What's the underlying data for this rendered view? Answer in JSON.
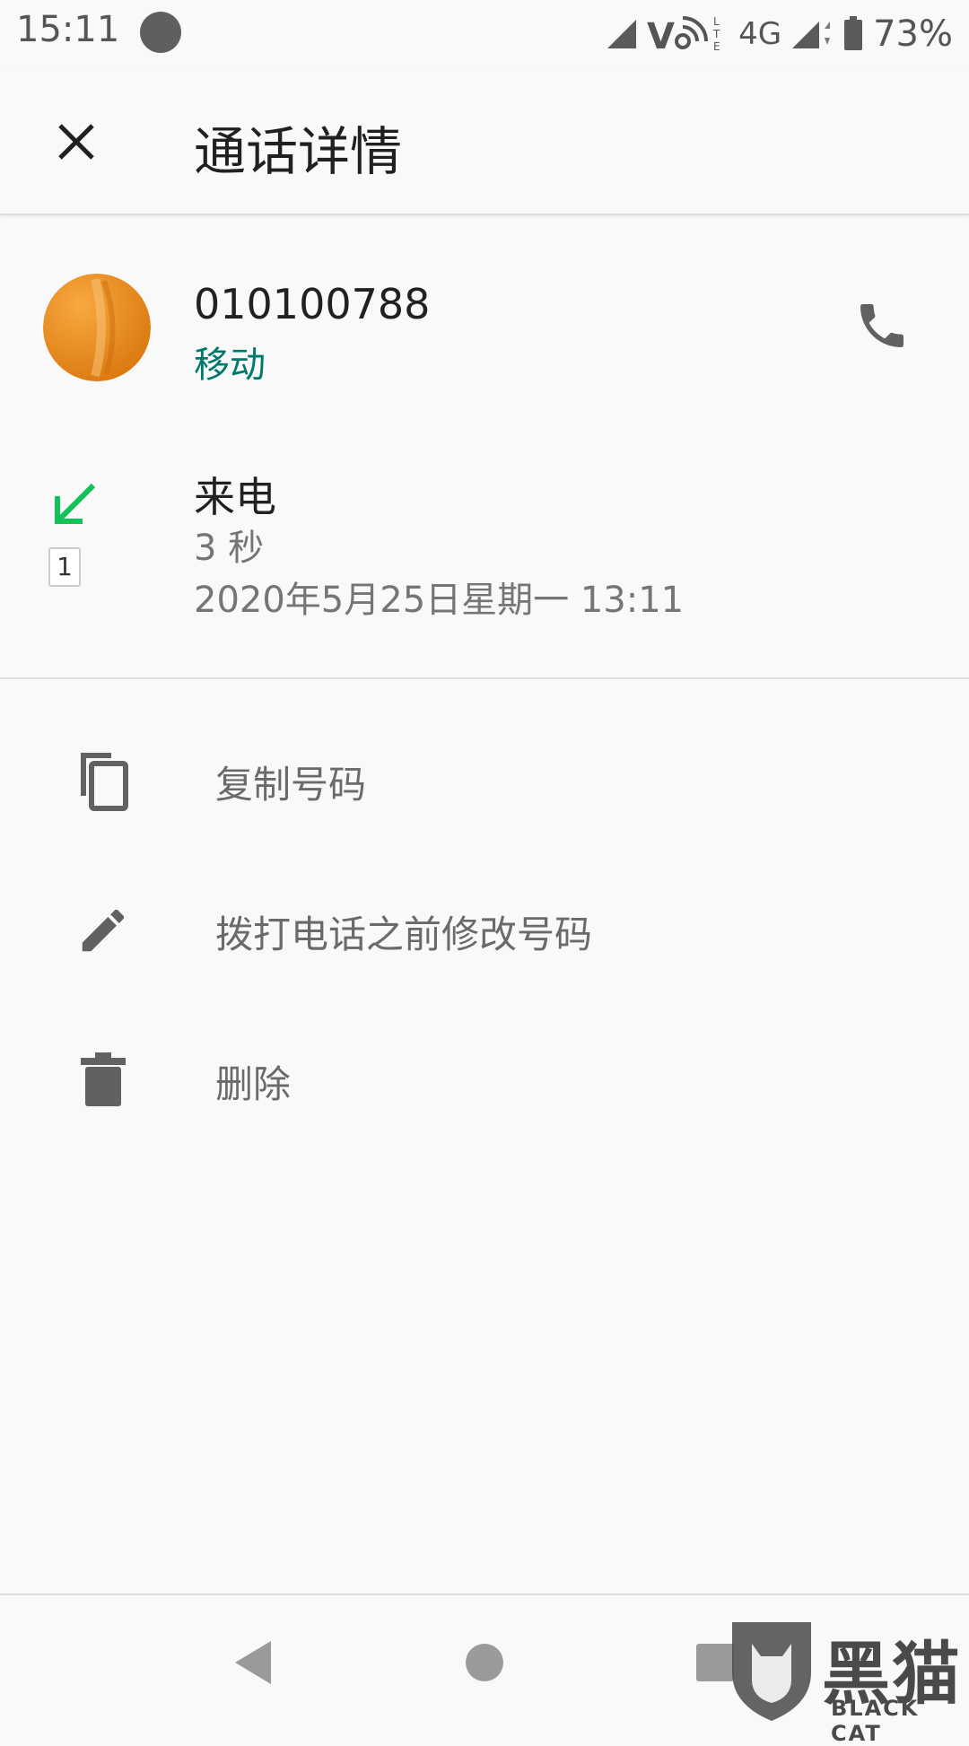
{
  "status_bar": {
    "time": "15:11",
    "network": "4G",
    "battery": "73%",
    "icons": [
      "signal-icon",
      "volte-icon",
      "signal-icon",
      "battery-icon"
    ]
  },
  "header": {
    "title": "通话详情",
    "close_icon": "close-icon"
  },
  "contact": {
    "number": "010100788",
    "carrier": "移动",
    "call_icon": "phone-icon"
  },
  "call": {
    "type": "来电",
    "sim": "1",
    "duration": "3 秒",
    "datetime": "2020年5月25日星期一 13:11",
    "type_icon": "incoming-call-arrow-icon"
  },
  "actions": [
    {
      "label": "复制号码",
      "icon": "copy-icon"
    },
    {
      "label": "拨打电话之前修改号码",
      "icon": "edit-icon"
    },
    {
      "label": "删除",
      "icon": "delete-icon"
    }
  ],
  "nav": {
    "icons": [
      "back-icon",
      "home-icon",
      "recents-icon"
    ]
  },
  "watermark": {
    "cn": "黑猫",
    "en": "BLACK CAT"
  },
  "colors": {
    "carrier": "#00796b",
    "incoming_arrow": "#14c25a",
    "avatar": "#e88e1c",
    "background": "#f9f9f9"
  }
}
